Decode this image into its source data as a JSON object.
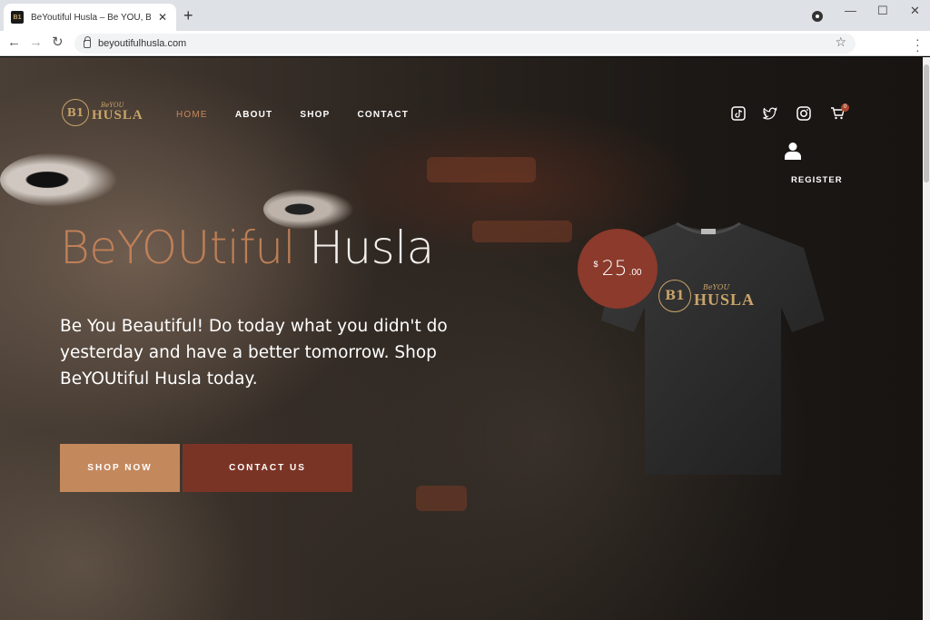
{
  "browser": {
    "tab_title": "BeYoutiful Husla – Be YOU, BeYo",
    "favicon_text": "B1",
    "url": "beyoutifulhusla.com"
  },
  "site": {
    "logo": {
      "monogram": "B1",
      "small": "BeYOU",
      "big": "HUSLA"
    },
    "nav": [
      "HOME",
      "ABOUT",
      "SHOP",
      "CONTACT"
    ],
    "active_nav": "HOME",
    "social_icons": [
      "tiktok-icon",
      "twitter-icon",
      "instagram-icon",
      "cart-icon"
    ],
    "cart_count": "0",
    "register_label": "REGISTER"
  },
  "hero": {
    "title_part1": "BeYOUtiful",
    "title_part2": "Husla",
    "text": "Be You Beautiful! Do today what you didn't do yesterday and have a better tomorrow. Shop BeYOUtiful Husla today.",
    "shop_button": "SHOP NOW",
    "contact_button": "CONTACT US"
  },
  "product": {
    "currency": "$",
    "price_main": "25",
    "price_cents": ".00",
    "shirt_logo": {
      "monogram": "B1",
      "small": "BeYOU",
      "big": "HUSLA"
    }
  },
  "colors": {
    "accent_gold": "#c9a46a",
    "accent_copper": "#c4885d",
    "accent_rust": "#7a3425",
    "price_bg": "#8b3a2b"
  }
}
